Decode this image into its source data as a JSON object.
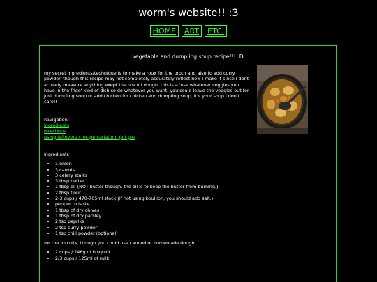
{
  "site": {
    "title": "worm's website!! :3"
  },
  "nav": {
    "links": [
      "HOME",
      "ART",
      "ETC."
    ]
  },
  "recipe": {
    "title": "vegetable and dumpling soup recipe!!! :D",
    "intro": "my secret ingredients/technique is to make a roux for the broth and also to add curry powder. though this recipe may not completely accurately reflect how i make it since i dont actually measure anything exept the biscuit dough. this is a 'use whatever veggies you have in the frige' kind of dish so do whatever you want. you could leave the veggies out for just dumpling soup or add chicken for chicken and dumpling soup, it's your soup i don't care!!",
    "navigation_label": "navigation:",
    "navigation_links": [
      "ingredients",
      "directions",
      "using leftovers / recipe variation: pot pie"
    ],
    "ingredients_label": "ingredients",
    "ingredients": [
      "1 onion",
      "3 carrots",
      "3 celery stalks",
      "3 tbsp butter",
      "1 tbsp oil (NOT butter though, the oil is to keep the butter from burning.)",
      "2 tbsp flour",
      "2-3 cups / 470-705ml stock (if not using boullion, you should add salt.)",
      "pepper to taste",
      "1 tbsp of dry chives",
      "1 tbsp of dry parsley",
      "2 tsp paprika",
      "2 tsp curry powder",
      "1 tsp chili powder (optional)"
    ],
    "biscuit_note": "for the biscuits, though you could use canned or homemade dough",
    "biscuit_ingredients": [
      "2 cups / 246g of bisquick",
      "2/3 cups / 125ml of milk"
    ],
    "photo_icon": "soup-pot-photo"
  },
  "colors": {
    "background": "#000000",
    "accent_green": "#33ff33",
    "text": "#ffffff"
  }
}
